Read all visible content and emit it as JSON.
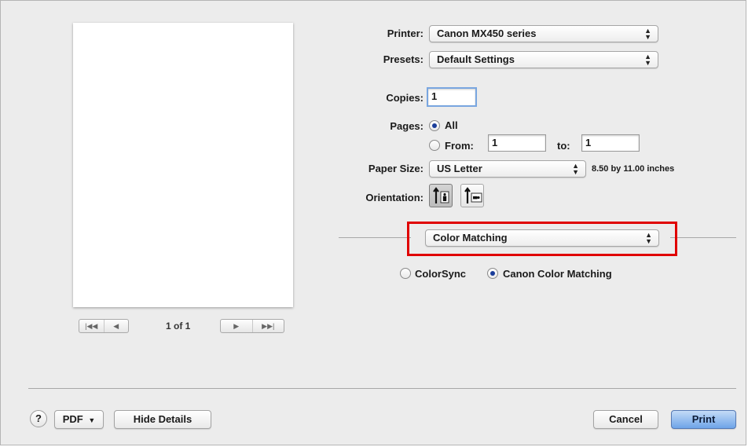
{
  "printer": {
    "label": "Printer:",
    "value": "Canon MX450 series"
  },
  "presets": {
    "label": "Presets:",
    "value": "Default Settings"
  },
  "copies": {
    "label": "Copies:",
    "value": "1"
  },
  "pages": {
    "label": "Pages:",
    "all_label": "All",
    "from_label": "From:",
    "from_value": "1",
    "to_label": "to:",
    "to_value": "1",
    "selected": "All"
  },
  "paper_size": {
    "label": "Paper Size:",
    "value": "US Letter",
    "dimensions": "8.50 by 11.00 inches"
  },
  "orientation": {
    "label": "Orientation:",
    "options": [
      "portrait",
      "landscape"
    ],
    "selected": "portrait"
  },
  "panel_popup": {
    "value": "Color Matching"
  },
  "color_matching": {
    "options": [
      "ColorSync",
      "Canon Color Matching"
    ],
    "selected": "Canon Color Matching"
  },
  "preview": {
    "page_indicator": "1 of 1"
  },
  "footer": {
    "help_label": "?",
    "pdf_label": "PDF",
    "hide_details_label": "Hide Details",
    "cancel_label": "Cancel",
    "print_label": "Print"
  },
  "colors": {
    "highlight": "#e00000",
    "default_button": "#6ea4e8",
    "radio_selected": "#1a3d9a"
  }
}
